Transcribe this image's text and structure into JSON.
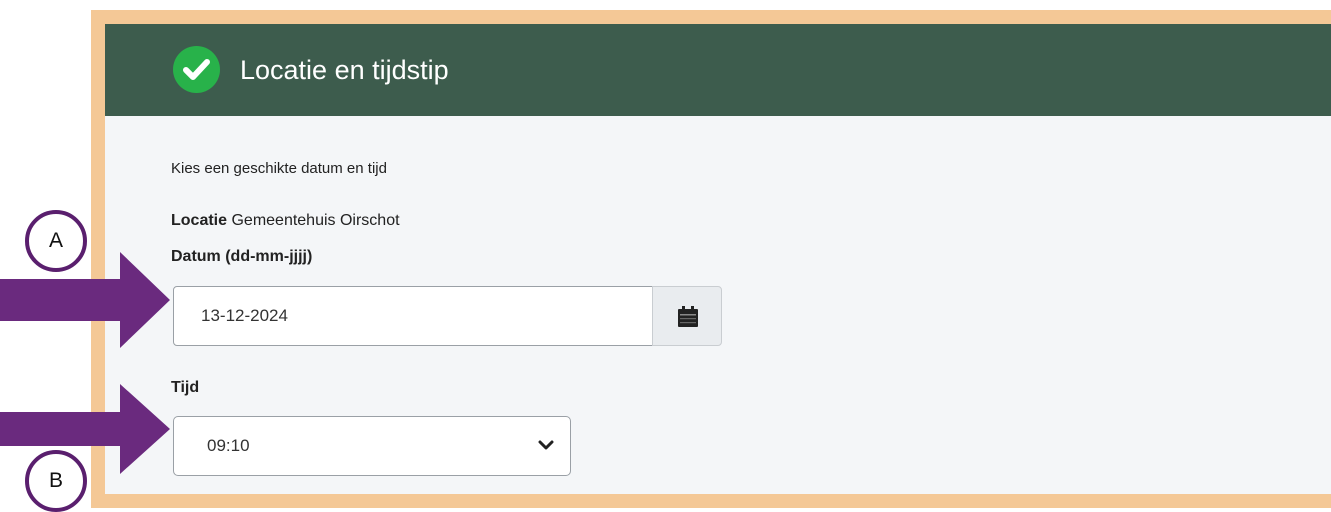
{
  "header": {
    "title": "Locatie en tijdstip",
    "icon": "check-circle-icon"
  },
  "form": {
    "intro": "Kies een geschikte datum en tijd",
    "location_label": "Locatie",
    "location_value": "Gemeentehuis Oirschot",
    "date_label": "Datum (dd-mm-jjjj)",
    "date_value": "13-12-2024",
    "time_label": "Tijd",
    "time_value": "09:10"
  },
  "annotations": {
    "marker_a": "A",
    "marker_b": "B"
  },
  "colors": {
    "header_bg": "#3d5c4d",
    "check_green": "#28b24a",
    "frame_border": "#f4c896",
    "arrow_purple": "#6a2a7e"
  }
}
